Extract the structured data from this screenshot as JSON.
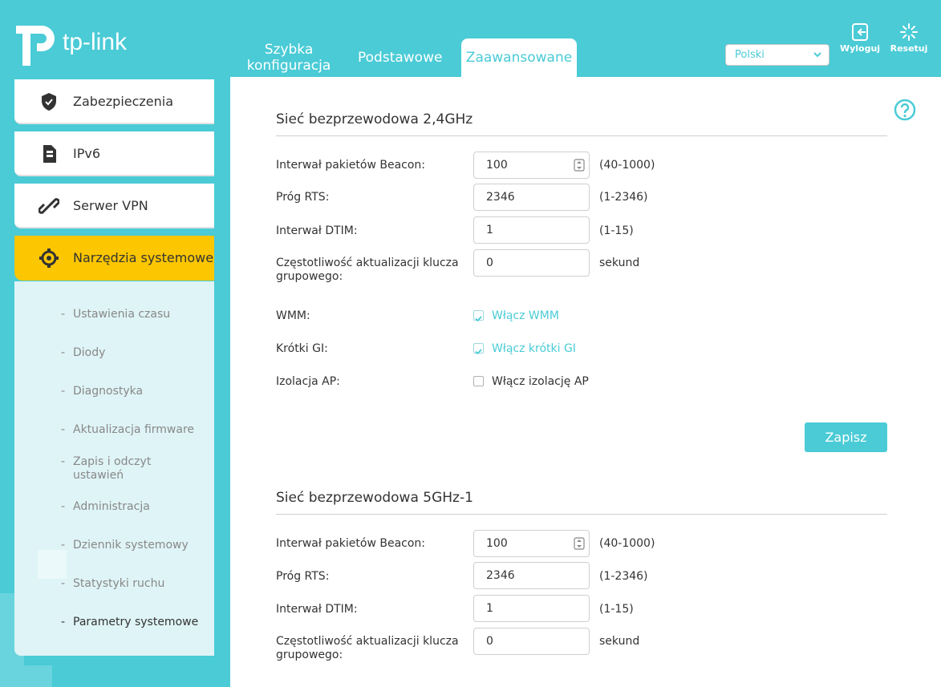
{
  "brand": {
    "name": "tp-link"
  },
  "nav_tabs": [
    {
      "label_line1": "Szybka",
      "label_line2": "konfiguracja"
    },
    {
      "label": "Podstawowe"
    },
    {
      "label": "Zaawansowane"
    }
  ],
  "language": {
    "selected": "Polski"
  },
  "header_actions": {
    "logout": "Wyloguj",
    "reset": "Resetuj"
  },
  "sidebar": {
    "items": [
      {
        "label": "Zabezpieczenia",
        "icon": "shield-icon"
      },
      {
        "label": "IPv6",
        "icon": "ipv6-icon"
      },
      {
        "label": "Serwer VPN",
        "icon": "link-icon"
      },
      {
        "label": "Narzędzia systemowe",
        "icon": "gear-icon"
      }
    ],
    "submenu": [
      "Ustawienia czasu",
      "Diody",
      "Diagnostyka",
      "Aktualizacja firmware",
      "Zapis i odczyt ustawień",
      "Administracja",
      "Dziennik systemowy",
      "Statystyki ruchu",
      "Parametry systemowe"
    ]
  },
  "section1": {
    "title": "Sieć bezprzewodowa 2,4GHz",
    "beacon": {
      "label": "Interwał pakietów Beacon:",
      "value": "100",
      "hint": "(40-1000)"
    },
    "rts": {
      "label": "Próg RTS:",
      "value": "2346",
      "hint": "(1-2346)"
    },
    "dtim": {
      "label": "Interwał DTIM:",
      "value": "1",
      "hint": "(1-15)"
    },
    "gkey": {
      "label": "Częstotliwość aktualizacji klucza grupowego:",
      "value": "0",
      "hint": "sekund"
    },
    "wmm": {
      "label": "WMM:",
      "option": "Włącz WMM",
      "checked": true
    },
    "shortgi": {
      "label": "Krótki GI:",
      "option": "Włącz krótki GI",
      "checked": true
    },
    "apiso": {
      "label": "Izolacja AP:",
      "option": "Włącz izolację AP",
      "checked": false
    },
    "save": "Zapisz"
  },
  "section2": {
    "title": "Sieć bezprzewodowa 5GHz-1",
    "beacon": {
      "label": "Interwał pakietów Beacon:",
      "value": "100",
      "hint": "(40-1000)"
    },
    "rts": {
      "label": "Próg RTS:",
      "value": "2346",
      "hint": "(1-2346)"
    },
    "dtim": {
      "label": "Interwał DTIM:",
      "value": "1",
      "hint": "(1-15)"
    },
    "gkey": {
      "label": "Częstotliwość aktualizacji klucza grupowego:",
      "value": "0",
      "hint": "sekund"
    }
  },
  "colors": {
    "accent": "#4acbd6",
    "active_menu": "#fcc600"
  }
}
